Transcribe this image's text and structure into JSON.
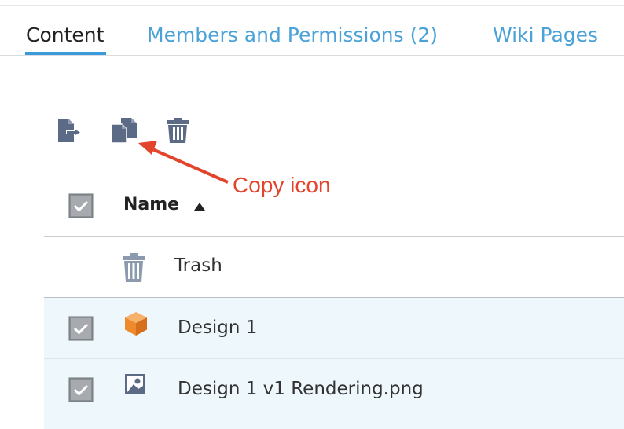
{
  "tabs": [
    {
      "label": "Content",
      "active": true
    },
    {
      "label": "Members and Permissions (2)",
      "active": false
    },
    {
      "label": "Wiki Pages",
      "active": false
    }
  ],
  "toolbar": {
    "move_icon": "move-to-icon",
    "copy_icon": "copy-icon",
    "delete_icon": "trash-icon"
  },
  "annotation": {
    "text": "Copy icon",
    "color": "#e2452c"
  },
  "table": {
    "header": {
      "name": "Name",
      "sort": "ascending"
    },
    "rows": [
      {
        "label": "Trash",
        "icon": "trash-folder-icon",
        "checked": null
      },
      {
        "label": "Design 1",
        "icon": "3d-model-icon",
        "checked": true
      },
      {
        "label": "Design 1 v1 Rendering.png",
        "icon": "image-file-icon",
        "checked": true
      }
    ]
  },
  "colors": {
    "accent": "#3b9ad9",
    "link": "#4aa2d8",
    "icon": "#5b6b85",
    "selected_row": "#eef7fc",
    "checkbox": "#8a8f94"
  }
}
